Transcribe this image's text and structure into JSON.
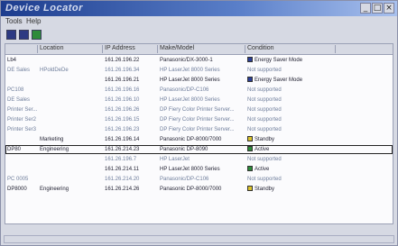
{
  "window": {
    "title": "Device Locator"
  },
  "menus": [
    "Tools",
    "Help"
  ],
  "toolbar": [
    "refresh-button",
    "view-button",
    "properties-button"
  ],
  "columns": [
    "",
    "Location",
    "IP Address",
    "Make/Model",
    "Condition"
  ],
  "rows": [
    {
      "name": "Lb4",
      "location": "",
      "ip": "161.26.196.22",
      "model": "Panasonic/DX-3000-1",
      "condition": "Energy Saver Mode",
      "icon": "blue",
      "dark": true
    },
    {
      "name": "DE Sales",
      "location": "HPoldDeDe",
      "ip": "161.26.196.34",
      "model": "HP LaserJet 8000 Series",
      "condition": "Not supported",
      "icon": "",
      "dark": false
    },
    {
      "name": "",
      "location": "",
      "ip": "161.26.196.21",
      "model": "HP LaserJet 8000 Series",
      "condition": "Energy Saver Mode",
      "icon": "blue",
      "dark": true
    },
    {
      "name": "PC108",
      "location": "",
      "ip": "161.26.196.16",
      "model": "Panasonic/DP-C106",
      "condition": "Not supported",
      "icon": "",
      "dark": false
    },
    {
      "name": "DE Sales",
      "location": "",
      "ip": "161.26.196.10",
      "model": "HP LaserJet 8000 Series",
      "condition": "Not supported",
      "icon": "",
      "dark": false
    },
    {
      "name": "Printer Ser...",
      "location": "",
      "ip": "161.26.196.26",
      "model": "DP Fiery Color Printer Server...",
      "condition": "Not supported",
      "icon": "",
      "dark": false
    },
    {
      "name": "Printer Ser2",
      "location": "",
      "ip": "161.26.196.15",
      "model": "DP Fiery Color Printer Server...",
      "condition": "Not supported",
      "icon": "",
      "dark": false
    },
    {
      "name": "Printer Ser3",
      "location": "",
      "ip": "161.26.196.23",
      "model": "DP Fiery Color Printer Server...",
      "condition": "Not supported",
      "icon": "",
      "dark": false
    },
    {
      "name": "",
      "location": "Marketing",
      "ip": "161.26.196.14",
      "model": "Panasonic DP-8000/7000",
      "condition": "Standby",
      "icon": "yellow",
      "dark": true
    },
    {
      "name": "DP80",
      "location": "Engineering",
      "ip": "161.26.214.23",
      "model": "Panasonic DP-8090",
      "condition": "Active",
      "icon": "green",
      "dark": true,
      "selected": true
    },
    {
      "name": "",
      "location": "",
      "ip": "161.26.196.7",
      "model": "HP LaserJet",
      "condition": "Not supported",
      "icon": "",
      "dark": false
    },
    {
      "name": "",
      "location": "",
      "ip": "161.26.214.11",
      "model": "HP LaserJet 8000 Series",
      "condition": "Active",
      "icon": "green",
      "dark": true
    },
    {
      "name": "PC 0005",
      "location": "",
      "ip": "161.26.214.20",
      "model": "Panasonic/DP-C106",
      "condition": "Not supported",
      "icon": "",
      "dark": false
    },
    {
      "name": "DP8000",
      "location": "Engineering",
      "ip": "161.26.214.26",
      "model": "Panasonic DP-8000/7000",
      "condition": "Standby",
      "icon": "yellow",
      "dark": true
    }
  ],
  "colors": {
    "blue": "#2c3f96",
    "green": "#2e8b3a",
    "yellow": "#d9c22b"
  }
}
